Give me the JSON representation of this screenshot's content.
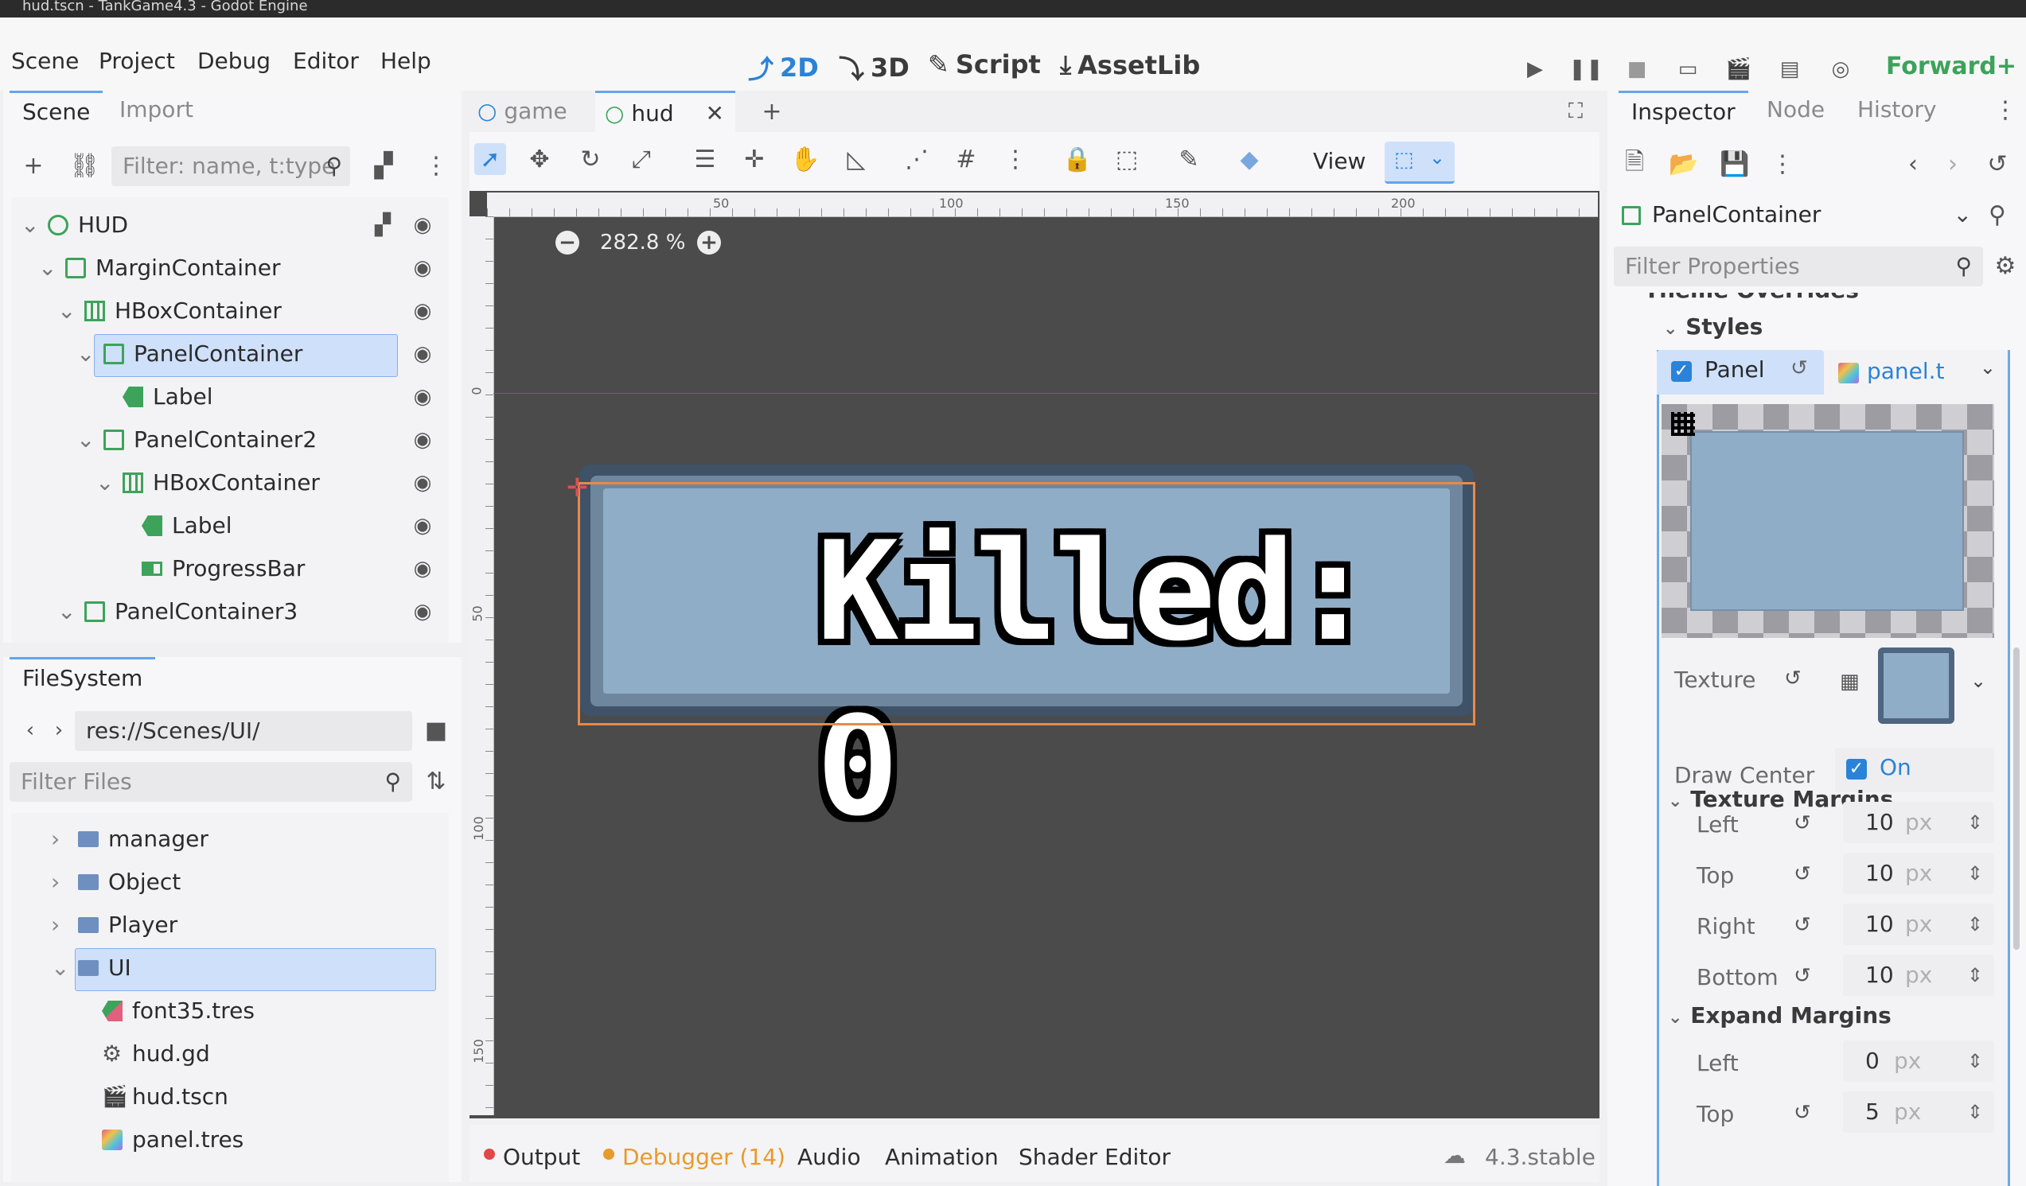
{
  "window": {
    "title": "hud.tscn - TankGame4.3 - Godot Engine"
  },
  "menu": {
    "items": [
      "Scene",
      "Project",
      "Debug",
      "Editor",
      "Help"
    ]
  },
  "workspaces": {
    "w2d": "2D",
    "w3d": "3D",
    "script": "Script",
    "assetlib": "AssetLib"
  },
  "renderer": {
    "label": "Forward+"
  },
  "scene_dock": {
    "tabs": [
      "Scene",
      "Import"
    ],
    "filter_placeholder": "Filter: name, t:type",
    "nodes": [
      "HUD",
      "MarginContainer",
      "HBoxContainer",
      "PanelContainer",
      "Label",
      "PanelContainer2",
      "HBoxContainer",
      "Label",
      "ProgressBar",
      "PanelContainer3"
    ]
  },
  "filesystem_dock": {
    "tab": "FileSystem",
    "path": "res://Scenes/UI/",
    "filter_placeholder": "Filter Files",
    "items": [
      "manager",
      "Object",
      "Player",
      "UI",
      "font35.tres",
      "hud.gd",
      "hud.tscn",
      "panel.tres"
    ]
  },
  "editor_tabs": [
    "game",
    "hud"
  ],
  "toolbar": {
    "view_label": "View"
  },
  "viewport": {
    "zoom": "282.8 %",
    "ruler_h": [
      "50",
      "100",
      "150",
      "200"
    ],
    "ruler_v": [
      "0",
      "50",
      "100",
      "150"
    ],
    "hud_text": "Killed: 0"
  },
  "bottom_panel": {
    "tabs": [
      "Output",
      "Debugger (14)",
      "Audio",
      "Animation",
      "Shader Editor"
    ],
    "version": "4.3.stable"
  },
  "inspector": {
    "tabs": [
      "Inspector",
      "Node",
      "History"
    ],
    "node_type": "PanelContainer",
    "filter_placeholder": "Filter Properties",
    "theme_overrides_label": "Theme Overrides",
    "styles_label": "Styles",
    "panel_label": "Panel",
    "panel_resource": "panel.t",
    "texture_label": "Texture",
    "draw_center_label": "Draw Center",
    "draw_center_value": "On",
    "texture_margins_label": "Texture Margins",
    "texture_margins": [
      {
        "label": "Left",
        "value": "10",
        "unit": "px"
      },
      {
        "label": "Top",
        "value": "10",
        "unit": "px"
      },
      {
        "label": "Right",
        "value": "10",
        "unit": "px"
      },
      {
        "label": "Bottom",
        "value": "10",
        "unit": "px"
      }
    ],
    "expand_margins_label": "Expand Margins",
    "expand_margins": [
      {
        "label": "Left",
        "value": "0",
        "unit": "px"
      },
      {
        "label": "Top",
        "value": "5",
        "unit": "px"
      }
    ]
  },
  "colors": {
    "accent": "#2a83d8",
    "selection": "#cfe0fb",
    "node_green": "#3da35a",
    "folder": "#6f8fc0",
    "viewport": "#4b4b4b",
    "panel_fill": "#90adc8"
  }
}
